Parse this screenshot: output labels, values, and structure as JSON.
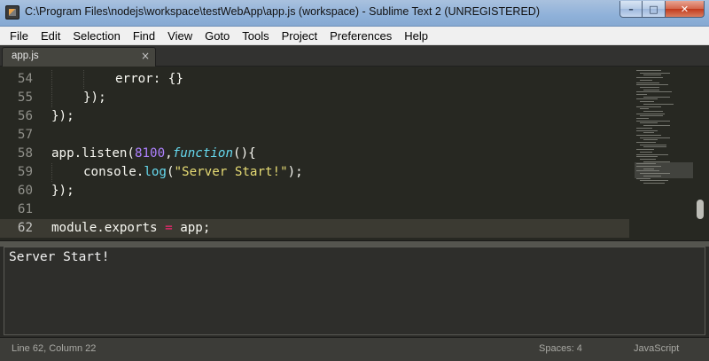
{
  "window": {
    "title": "C:\\Program Files\\nodejs\\workspace\\testWebApp\\app.js (workspace) - Sublime Text 2 (UNREGISTERED)",
    "minimize_glyph": "–",
    "maximize_glyph": "□",
    "close_glyph": "✕"
  },
  "menu": [
    "File",
    "Edit",
    "Selection",
    "Find",
    "View",
    "Goto",
    "Tools",
    "Project",
    "Preferences",
    "Help"
  ],
  "tabs": [
    {
      "label": "app.js",
      "close_glyph": "×"
    }
  ],
  "editor": {
    "lines": [
      {
        "number": "54",
        "indent": 2,
        "tokens": [
          {
            "t": "error: {}",
            "c": "plain"
          }
        ]
      },
      {
        "number": "55",
        "indent": 1,
        "tokens": [
          {
            "t": "});",
            "c": "plain"
          }
        ]
      },
      {
        "number": "56",
        "indent": 0,
        "tokens": [
          {
            "t": "});",
            "c": "plain"
          }
        ]
      },
      {
        "number": "57",
        "indent": 0,
        "tokens": []
      },
      {
        "number": "58",
        "indent": 0,
        "tokens": [
          {
            "t": "app.",
            "c": "plain"
          },
          {
            "t": "listen",
            "c": "plain"
          },
          {
            "t": "(",
            "c": "plain"
          },
          {
            "t": "8100",
            "c": "num"
          },
          {
            "t": ",",
            "c": "plain"
          },
          {
            "t": "function",
            "c": "kw"
          },
          {
            "t": "(){",
            "c": "plain"
          }
        ]
      },
      {
        "number": "59",
        "indent": 1,
        "tokens": [
          {
            "t": "console.",
            "c": "plain"
          },
          {
            "t": "log",
            "c": "fn"
          },
          {
            "t": "(",
            "c": "plain"
          },
          {
            "t": "\"Server Start!\"",
            "c": "str"
          },
          {
            "t": ");",
            "c": "plain"
          }
        ]
      },
      {
        "number": "60",
        "indent": 0,
        "tokens": [
          {
            "t": "});",
            "c": "plain"
          }
        ]
      },
      {
        "number": "61",
        "indent": 0,
        "tokens": []
      },
      {
        "number": "62",
        "indent": 0,
        "current": true,
        "tokens": [
          {
            "t": "module.exports ",
            "c": "plain"
          },
          {
            "t": "=",
            "c": "op"
          },
          {
            "t": " app;",
            "c": "plain"
          }
        ]
      }
    ]
  },
  "console": {
    "output": "Server Start!"
  },
  "status": {
    "position": "Line 62, Column 22",
    "indentation": "Spaces: 4",
    "syntax": "JavaScript"
  },
  "colors": {
    "background": "#272822",
    "keyword": "#66d9ef",
    "number": "#ae81ff",
    "string": "#e6db74",
    "operator": "#f92672",
    "text": "#f8f8f2"
  }
}
